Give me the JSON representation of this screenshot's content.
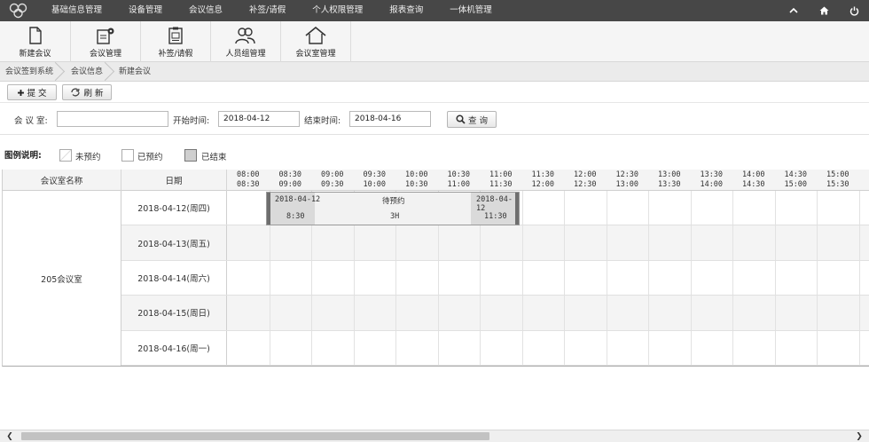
{
  "nav": {
    "items": [
      "基础信息管理",
      "设备管理",
      "会议信息",
      "补签/请假",
      "个人权限管理",
      "报表查询",
      "一体机管理"
    ]
  },
  "toolbar": {
    "items": [
      "新建会议",
      "会议管理",
      "补签/请假",
      "人员组管理",
      "会议室管理"
    ]
  },
  "breadcrumb": [
    "会议签到系统",
    "会议信息",
    "新建会议"
  ],
  "actions": {
    "submit": "✚ 提 交",
    "refresh": "刷 新"
  },
  "search": {
    "room_label": "会 议 室:",
    "room_value": "",
    "start_label": "开始时间:",
    "start_value": "2018-04-12",
    "end_label": "结束时间:",
    "end_value": "2018-04-16",
    "query_label": "查 询"
  },
  "legend": {
    "title": "图例说明:",
    "items": [
      {
        "label": "未预约",
        "color": "#ffffff"
      },
      {
        "label": "已预约",
        "color": "#ffffff"
      },
      {
        "label": "已结束",
        "color": "#cfcfcf"
      }
    ]
  },
  "grid": {
    "col_room": "会议室名称",
    "col_date": "日期",
    "slots": [
      [
        "08:00",
        "08:30"
      ],
      [
        "08:30",
        "09:00"
      ],
      [
        "09:00",
        "09:30"
      ],
      [
        "09:30",
        "10:00"
      ],
      [
        "10:00",
        "10:30"
      ],
      [
        "10:30",
        "11:00"
      ],
      [
        "11:00",
        "11:30"
      ],
      [
        "11:30",
        "12:00"
      ],
      [
        "12:00",
        "12:30"
      ],
      [
        "12:30",
        "13:00"
      ],
      [
        "13:00",
        "13:30"
      ],
      [
        "13:30",
        "14:00"
      ],
      [
        "14:00",
        "14:30"
      ],
      [
        "14:30",
        "15:00"
      ],
      [
        "15:00",
        "15:30"
      ]
    ],
    "room": "205会议室",
    "dates": [
      "2018-04-12(周四)",
      "2018-04-13(周五)",
      "2018-04-14(周六)",
      "2018-04-15(周日)",
      "2018-04-16(周一)"
    ]
  },
  "booking": {
    "start_date": "2018-04-12",
    "start_time": "8:30",
    "status": "待预约",
    "duration": "3H",
    "end_date": "2018-04-12",
    "end_time": "11:30"
  },
  "scrollbar": {
    "left": "❮",
    "right": "❯"
  }
}
